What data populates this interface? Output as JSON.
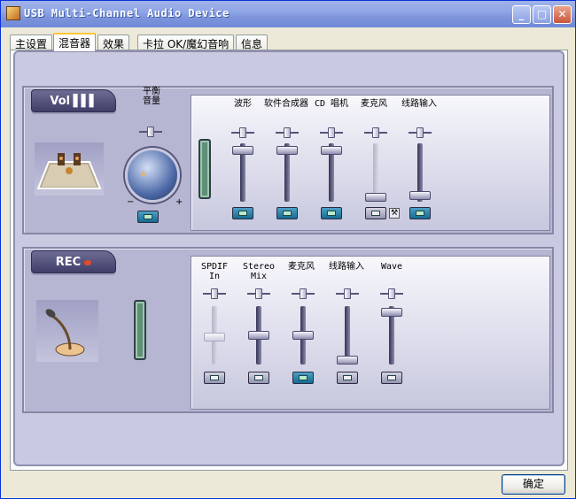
{
  "window": {
    "title": "USB Multi-Channel Audio Device"
  },
  "controls": {
    "minimize": "_",
    "maximize": "□",
    "close": "✕"
  },
  "tabs": [
    {
      "label": "主设置"
    },
    {
      "label": "混音器",
      "active": true
    },
    {
      "label": "效果"
    },
    {
      "label": "卡拉 OK/魔幻音响"
    },
    {
      "label": "信息"
    }
  ],
  "playback": {
    "badge": "Vol",
    "balance_label": "平衡\n音量",
    "minus": "−",
    "plus": "+",
    "channels": [
      {
        "label": "波形"
      },
      {
        "label": "软件合成器"
      },
      {
        "label": "CD 唱机"
      },
      {
        "label": "麦克风"
      },
      {
        "label": "线路输入"
      }
    ]
  },
  "record": {
    "badge": "REC",
    "channels": [
      {
        "label": "SPDIF In"
      },
      {
        "label": "Stereo Mix"
      },
      {
        "label": "麦克风"
      },
      {
        "label": "线路输入"
      },
      {
        "label": "Wave"
      }
    ]
  },
  "buttons": {
    "ok": "确定"
  },
  "icons": {
    "app": "speaker-app-icon",
    "speaker_stage": "speaker-stage-icon",
    "microphone": "microphone-icon",
    "advanced": "wrench-icon"
  },
  "colors": {
    "panel": "#b6b6d2",
    "active_mute": "#2a86b3",
    "title_bar": "#8fa6e6"
  }
}
